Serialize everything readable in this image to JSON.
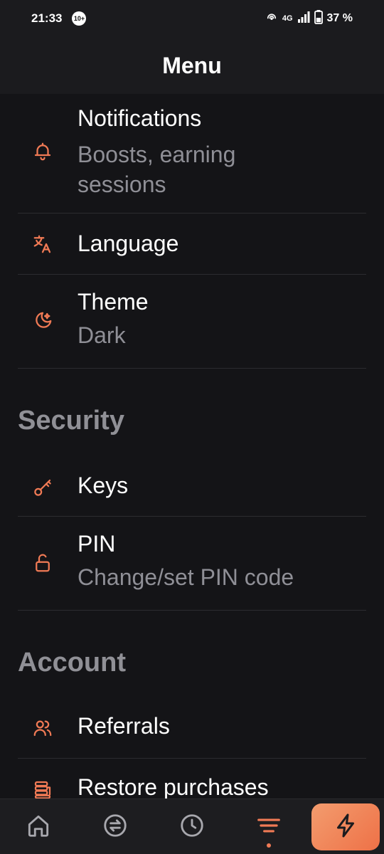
{
  "status_bar": {
    "time": "21:33",
    "badge": "10+",
    "network": "4G",
    "battery": "37 %"
  },
  "app_bar": {
    "title": "Menu"
  },
  "menu": {
    "items": [
      {
        "title": "Notifications",
        "subtitle": "Boosts, earning sessions",
        "icon": "bell-icon"
      },
      {
        "title": "Language",
        "icon": "translate-icon"
      },
      {
        "title": "Theme",
        "subtitle": "Dark",
        "icon": "moon-icon"
      }
    ],
    "security": {
      "heading": "Security",
      "items": [
        {
          "title": "Keys",
          "icon": "key-icon"
        },
        {
          "title": "PIN",
          "subtitle": "Change/set PIN code",
          "icon": "unlock-icon"
        }
      ]
    },
    "account": {
      "heading": "Account",
      "items": [
        {
          "title": "Referrals",
          "icon": "users-icon"
        },
        {
          "title": "Restore purchases",
          "icon": "coins-icon"
        }
      ]
    }
  },
  "bottom_nav": {
    "items": [
      "home-icon",
      "exchange-icon",
      "clock-icon",
      "menu-icon",
      "lightning-icon"
    ],
    "active": "menu-icon"
  },
  "colors": {
    "accent": "#f07a55",
    "background": "#141417",
    "bar": "#1b1b1e",
    "secondary_text": "#8f8f96"
  }
}
